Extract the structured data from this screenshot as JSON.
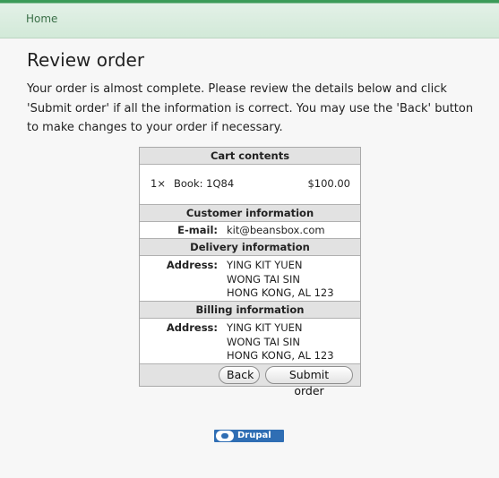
{
  "breadcrumb": {
    "home_label": "Home"
  },
  "page": {
    "title": "Review order",
    "intro": "Your order is almost complete. Please review the details below and click 'Submit order' if all the information is correct. You may use the 'Back' button to make changes to your order if necessary."
  },
  "review": {
    "cart": {
      "heading": "Cart contents",
      "items": [
        {
          "qty": "1×",
          "title": "Book: 1Q84",
          "price": "$100.00"
        }
      ]
    },
    "customer": {
      "heading": "Customer information",
      "email_label": "E-mail:",
      "email_value": "kit@beansbox.com"
    },
    "delivery": {
      "heading": "Delivery information",
      "address_label": "Address:",
      "address_lines": [
        "YING KIT YUEN",
        "WONG TAI SIN",
        "HONG KONG, AL 123"
      ]
    },
    "billing": {
      "heading": "Billing information",
      "address_label": "Address:",
      "address_lines": [
        "YING KIT YUEN",
        "WONG TAI SIN",
        "HONG KONG, AL 123"
      ]
    },
    "buttons": {
      "back_label": "Back",
      "submit_label": "Submit order"
    }
  },
  "footer": {
    "badge_text": "Drupal",
    "badge_color": "#2f6eb4"
  },
  "colors": {
    "topbar_accent": "#3a9b58",
    "link": "#3a6f47"
  }
}
